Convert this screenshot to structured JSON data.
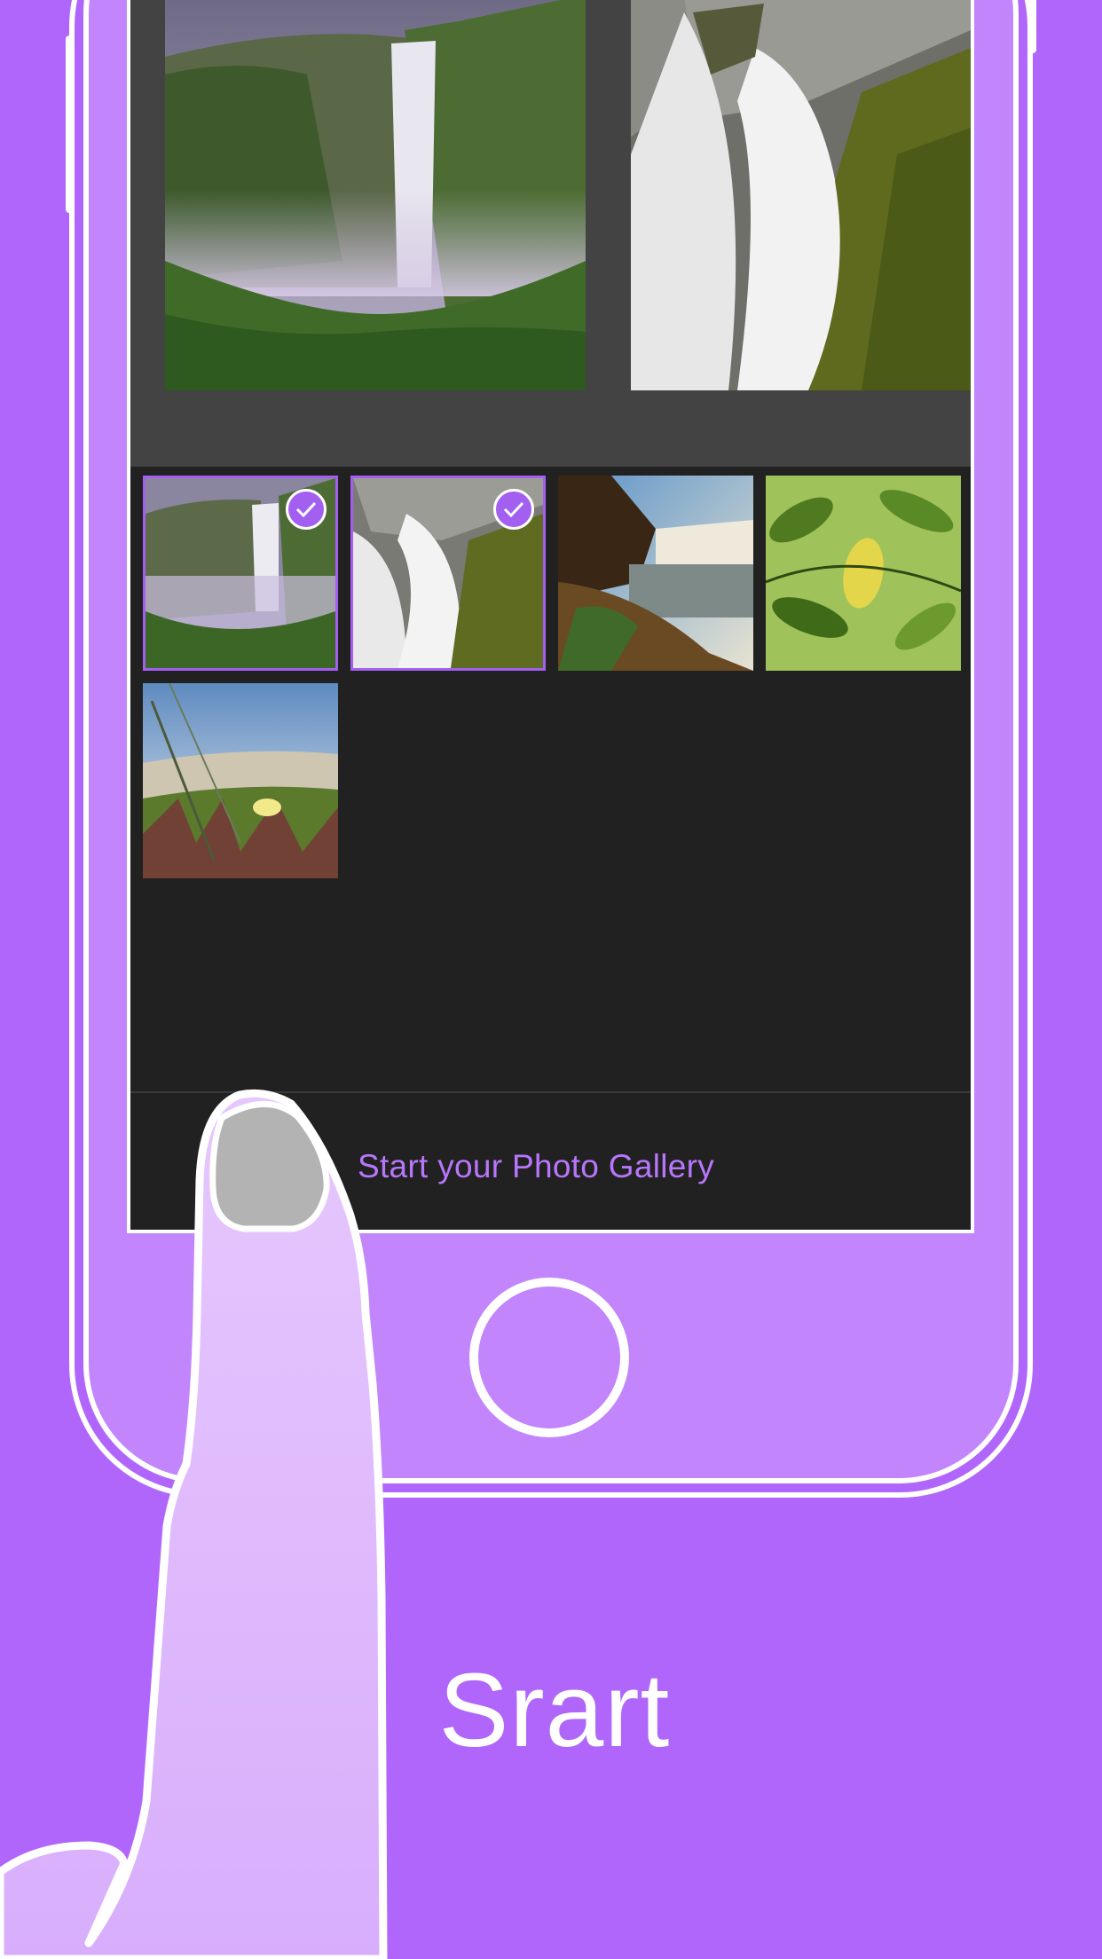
{
  "screen": {
    "action_label": "Start your Photo Gallery",
    "photos": [
      {
        "name": "waterfall-valley",
        "selected": true
      },
      {
        "name": "waterfall-closeup",
        "selected": true
      },
      {
        "name": "waterfall-rocks",
        "selected": false
      },
      {
        "name": "green-leaves",
        "selected": false
      },
      {
        "name": "beach-flower",
        "selected": false
      }
    ]
  },
  "caption": "Srart",
  "colors": {
    "background": "#b066fb",
    "phone": "#c285fc",
    "accent": "#a35ff0",
    "label": "#b876fb"
  }
}
